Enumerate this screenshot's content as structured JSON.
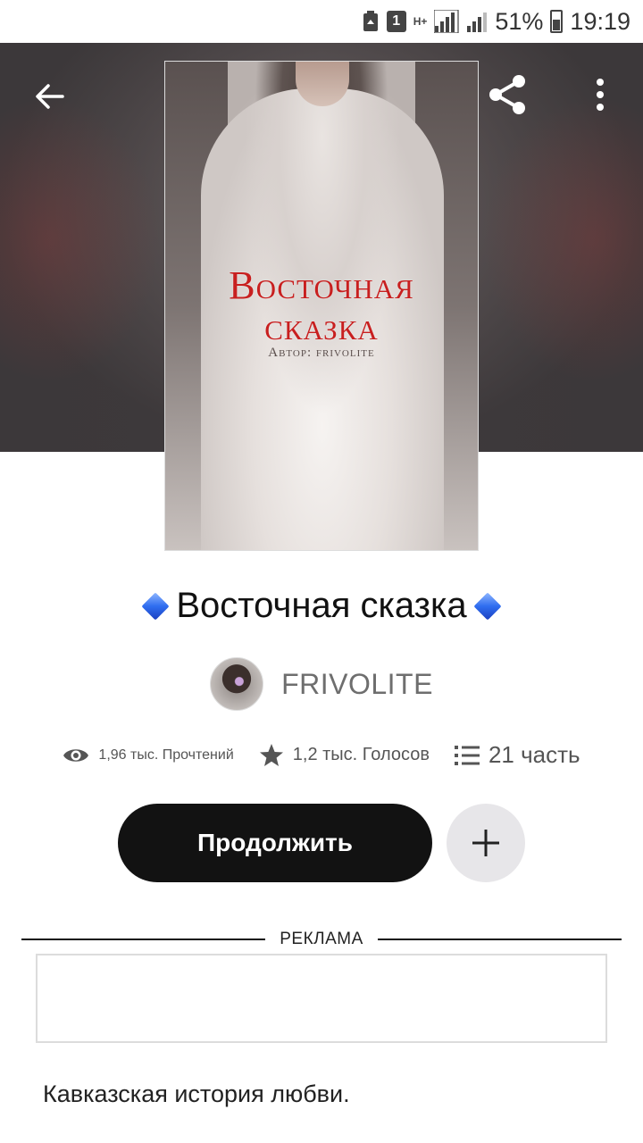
{
  "status_bar": {
    "sim": "1",
    "network": "H+",
    "battery": "51%",
    "time": "19:19"
  },
  "header": {
    "back_icon": "arrow-left-icon",
    "share_icon": "share-icon",
    "more_icon": "more-vertical-icon"
  },
  "cover": {
    "title_line1": "Восточная",
    "title_line2": "сказка",
    "author_line": "Автор: frivolite",
    "title_color": "#c81f1f"
  },
  "story": {
    "title": "Восточная сказка",
    "decoration_icon": "blue-diamond-icon",
    "author": "FRIVOLITE"
  },
  "stats": {
    "reads": "1,96 тыс. Прочтений",
    "votes": "1,2 тыс. Голосов",
    "parts": "21 часть"
  },
  "actions": {
    "continue_label": "Продолжить",
    "add_icon": "plus-icon"
  },
  "ad": {
    "label": "РЕКЛАМА"
  },
  "description": "Кавказская история любви."
}
